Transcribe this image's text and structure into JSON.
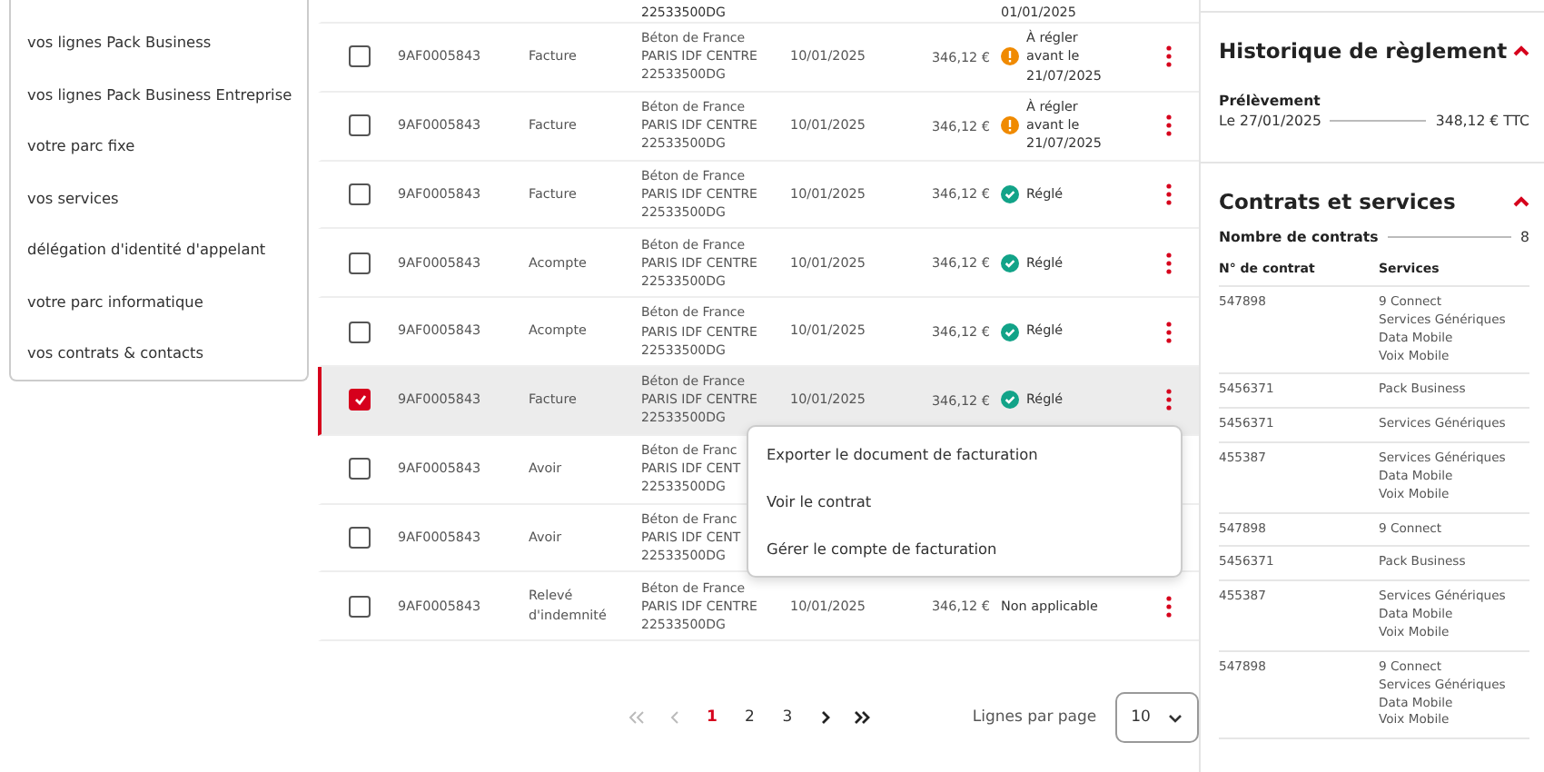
{
  "sidebar": {
    "items": [
      "vos lignes Pack Business",
      "vos lignes Pack Business Entreprise",
      "votre parc fixe",
      "vos services",
      "délégation d'identité d'appelant",
      "votre parc informatique",
      "vos contrats & contacts"
    ]
  },
  "invoices": {
    "partial_row": {
      "customer": "22533500DG",
      "status": "01/01/2025"
    },
    "rows": [
      {
        "selected": false,
        "number": "9AF0005843",
        "type": "Facture",
        "customer": [
          "Béton de France",
          "PARIS IDF CENTRE",
          "22533500DG"
        ],
        "date": "10/01/2025",
        "amount": "346,12 €",
        "kind": "due",
        "status": "À régler avant le 21/07/2025"
      },
      {
        "selected": false,
        "number": "9AF0005843",
        "type": "Facture",
        "customer": [
          "Béton de France",
          "PARIS IDF CENTRE",
          "22533500DG"
        ],
        "date": "10/01/2025",
        "amount": "346,12 €",
        "kind": "due",
        "status": "À régler avant le 21/07/2025"
      },
      {
        "selected": false,
        "number": "9AF0005843",
        "type": "Facture",
        "customer": [
          "Béton de France",
          "PARIS IDF CENTRE",
          "22533500DG"
        ],
        "date": "10/01/2025",
        "amount": "346,12 €",
        "kind": "paid",
        "status": "Réglé"
      },
      {
        "selected": false,
        "number": "9AF0005843",
        "type": "Acompte",
        "customer": [
          "Béton de France",
          "PARIS IDF CENTRE",
          "22533500DG"
        ],
        "date": "10/01/2025",
        "amount": "346,12 €",
        "kind": "paid",
        "status": "Réglé"
      },
      {
        "selected": false,
        "number": "9AF0005843",
        "type": "Acompte",
        "customer": [
          "Béton de France",
          "PARIS IDF CENTRE",
          "22533500DG"
        ],
        "date": "10/01/2025",
        "amount": "346,12 €",
        "kind": "paid",
        "status": "Réglé"
      },
      {
        "selected": true,
        "number": "9AF0005843",
        "type": "Facture",
        "customer": [
          "Béton de France",
          "PARIS IDF CENTRE",
          "22533500DG"
        ],
        "date": "10/01/2025",
        "amount": "346,12 €",
        "kind": "paid",
        "status": "Réglé"
      },
      {
        "selected": false,
        "number": "9AF0005843",
        "type": "Avoir",
        "customer": [
          "Béton de Franc",
          "PARIS IDF CENT",
          "22533500DG"
        ]
      },
      {
        "selected": false,
        "number": "9AF0005843",
        "type": "Avoir",
        "customer": [
          "Béton de Franc",
          "PARIS IDF CENT",
          "22533500DG"
        ]
      },
      {
        "selected": false,
        "number": "9AF0005843",
        "type": "Relevé d'indemnité",
        "customer": [
          "Béton de France",
          "PARIS IDF CENTRE",
          "22533500DG"
        ],
        "date": "10/01/2025",
        "amount": "346,12 €",
        "kind": "none",
        "status": "Non applicable"
      }
    ],
    "context_menu": {
      "items": [
        "Exporter le document de facturation",
        "Voir le contrat",
        "Gérer le compte de facturation"
      ]
    },
    "pagination": {
      "pages": [
        {
          "label": "1",
          "selected": true
        },
        {
          "label": "2",
          "selected": false
        },
        {
          "label": "3",
          "selected": false
        }
      ],
      "rows_label": "Lignes par page",
      "rows_value": "10"
    }
  },
  "payment_history": {
    "title": "Historique de règlement",
    "expanded": true,
    "method": "Prélèvement",
    "date": "Le 27/01/2025",
    "amount": "348,12 € TTC"
  },
  "contracts": {
    "title": "Contrats et services",
    "expanded": true,
    "count_label": "Nombre de contrats",
    "count": "8",
    "columns": [
      "N° de contrat",
      "Services"
    ],
    "rows": [
      {
        "number": "547898",
        "services": [
          "9 Connect",
          "Services Génériques",
          "Data Mobile",
          "Voix Mobile"
        ]
      },
      {
        "number": "5456371",
        "services": [
          "Pack Business"
        ]
      },
      {
        "number": "5456371",
        "services": [
          "Services Génériques"
        ]
      },
      {
        "number": "455387",
        "services": [
          "Services Génériques",
          "Data Mobile",
          "Voix Mobile"
        ]
      },
      {
        "number": "547898",
        "services": [
          "9 Connect"
        ]
      },
      {
        "number": "5456371",
        "services": [
          "Pack Business"
        ]
      },
      {
        "number": "455387",
        "services": [
          "Services Génériques",
          "Data Mobile",
          "Voix Mobile"
        ]
      },
      {
        "number": "547898",
        "services": [
          "9 Connect",
          "Services Génériques",
          "Data Mobile",
          "Voix Mobile"
        ]
      }
    ]
  }
}
